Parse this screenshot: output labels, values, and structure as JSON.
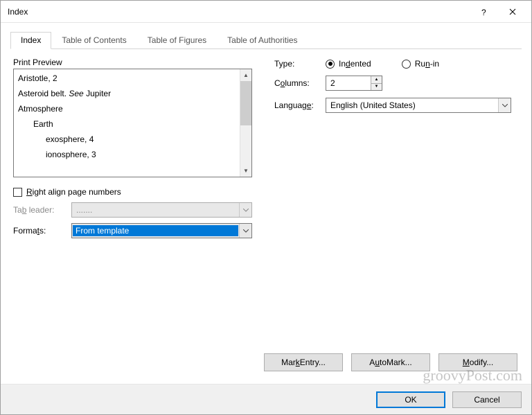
{
  "title": "Index",
  "tabs": [
    "Index",
    "Table of Contents",
    "Table of Figures",
    "Table of Authorities"
  ],
  "active_tab": 0,
  "preview_label": "Print Preview",
  "preview_lines": [
    {
      "text": "Aristotle, 2",
      "indent": 0
    },
    {
      "text_parts": [
        "Asteroid belt. ",
        "See",
        " Jupiter"
      ],
      "indent": 0,
      "see_idx": 1
    },
    {
      "text": "Atmosphere",
      "indent": 0
    },
    {
      "text": "Earth",
      "indent": 1
    },
    {
      "text": "exosphere, 4",
      "indent": 2
    },
    {
      "text": "ionosphere, 3",
      "indent": 2
    }
  ],
  "right_align_label": "Right align page numbers",
  "right_align_checked": false,
  "tab_leader_label": "Tab leader:",
  "tab_leader_value": ".......",
  "formats_label": "Formats:",
  "formats_value": "From template",
  "type_label": "Type:",
  "type_options": [
    "Indented",
    "Run-in"
  ],
  "type_selected": 0,
  "columns_label": "Columns:",
  "columns_value": "2",
  "language_label": "Language:",
  "language_value": "English (United States)",
  "buttons": {
    "mark_entry": "Mark Entry...",
    "automark": "AutoMark...",
    "modify": "Modify...",
    "ok": "OK",
    "cancel": "Cancel"
  },
  "watermark": "groovyPost.com"
}
